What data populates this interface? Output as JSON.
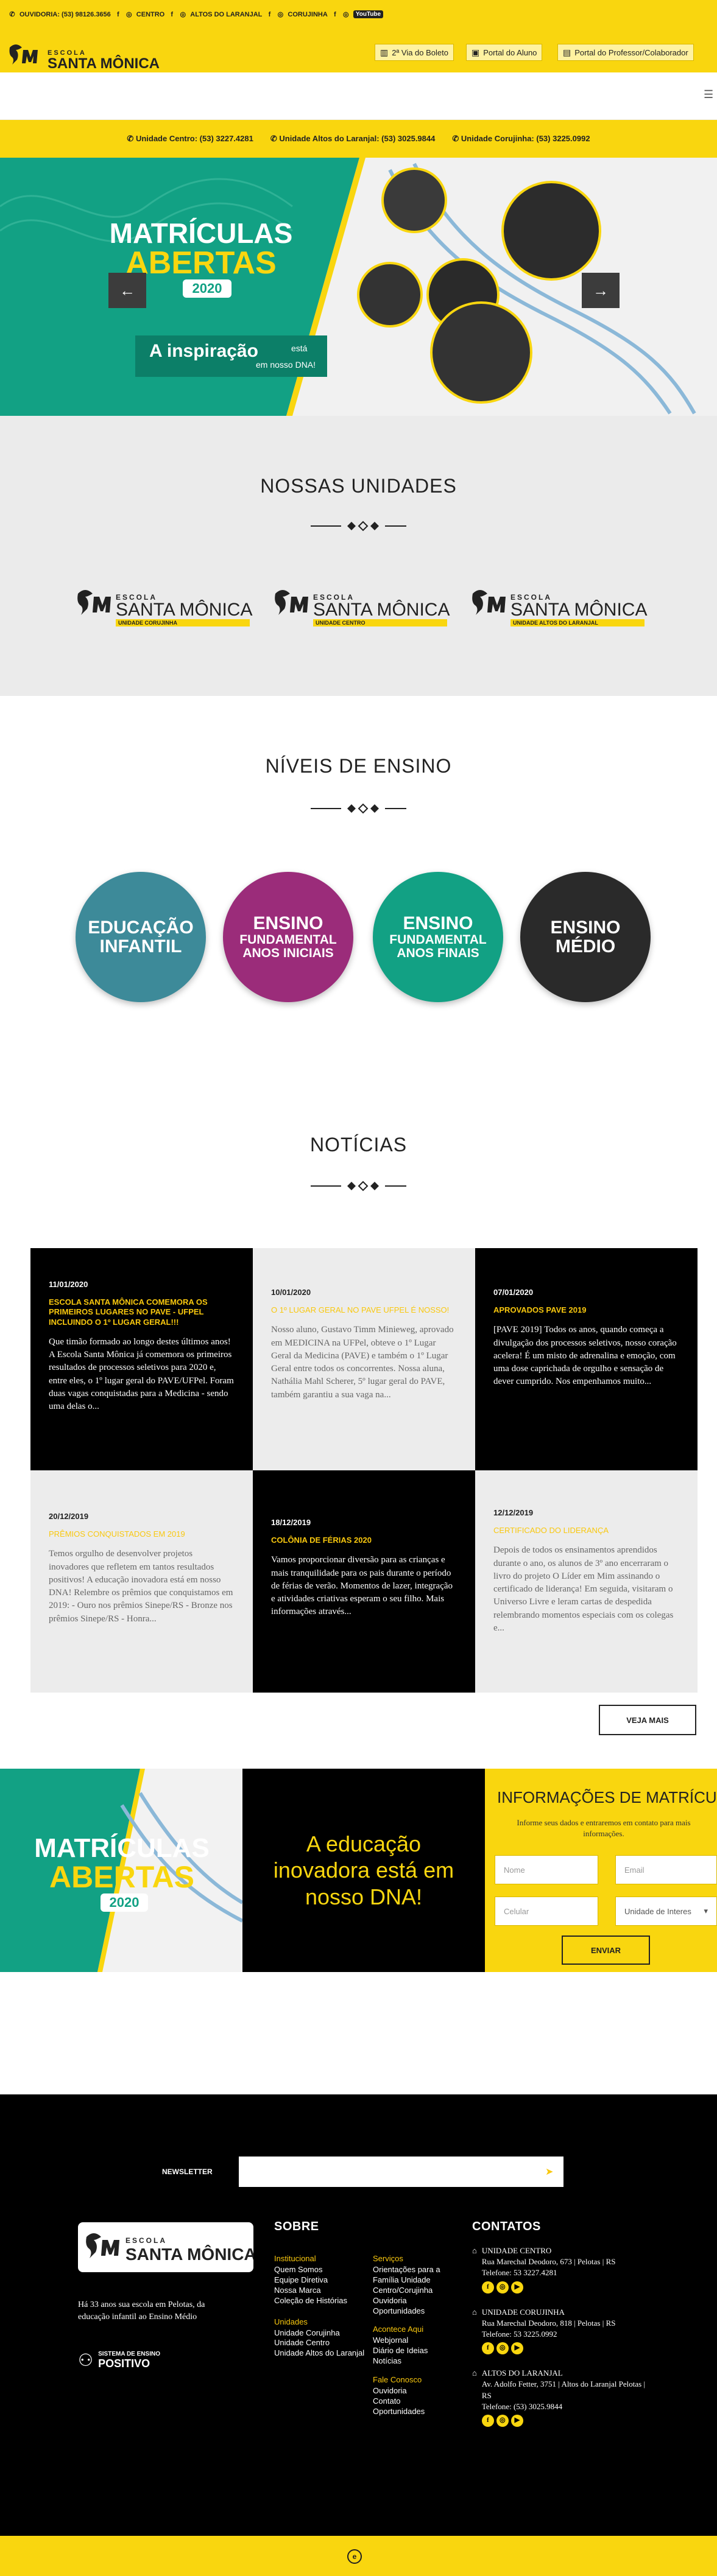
{
  "topbar": {
    "ouvidoria": "OUVIDORIA: (53) 98126.3656",
    "centro": "CENTRO",
    "altos": "ALTOS DO LARANJAL",
    "corujinha": "CORUJINHA",
    "youtube": "YouTube"
  },
  "header": {
    "logo_school": "ESCOLA",
    "logo_name": "SANTA MÔNICA",
    "portals": [
      "2ª Via do Boleto",
      "Portal do Aluno",
      "Portal do Professor/Colaborador"
    ]
  },
  "phones": [
    "Unidade Centro: (53) 3227.4281",
    "Unidade Altos do Laranjal: (53) 3025.9844",
    "Unidade Corujinha: (53) 3225.0992"
  ],
  "hero": {
    "line1": "MATRÍCULAS",
    "line2": "ABERTAS",
    "year": "2020",
    "tagline_bold": "A inspiração",
    "tagline_small1": "está",
    "tagline_small2": "em nosso DNA!",
    "prev": "←",
    "next": "→"
  },
  "units": {
    "title": "NOSSAS UNIDADES",
    "items": [
      {
        "school": "ESCOLA",
        "name": "SANTA MÔNICA",
        "sub": "UNIDADE CORUJINHA"
      },
      {
        "school": "ESCOLA",
        "name": "SANTA MÔNICA",
        "sub": "UNIDADE CENTRO"
      },
      {
        "school": "ESCOLA",
        "name": "SANTA MÔNICA",
        "sub": "UNIDADE ALTOS DO LARANJAL"
      }
    ]
  },
  "levels": {
    "title": "NÍVEIS DE ENSINO",
    "items": [
      {
        "l1": "EDUCAÇÃO",
        "l2": "INFANTIL",
        "l3": "",
        "color": "#3d8a99"
      },
      {
        "l1": "ENSINO",
        "l2": "FUNDAMENTAL",
        "l3": "ANOS INICIAIS",
        "color": "#9b2c7a"
      },
      {
        "l1": "ENSINO",
        "l2": "FUNDAMENTAL",
        "l3": "ANOS FINAIS",
        "color": "#12a184"
      },
      {
        "l1": "ENSINO",
        "l2": "MÉDIO",
        "l3": "",
        "color": "#2a2a2a"
      }
    ]
  },
  "news": {
    "title": "NOTÍCIAS",
    "more": "VEJA MAIS",
    "items": [
      {
        "date": "11/01/2020",
        "title": "ESCOLA SANTA MÔNICA COMEMORA OS PRIMEIROS LUGARES NO PAVE - UFPEL INCLUINDO O 1º LUGAR GERAL!!!",
        "excerpt": "Que timão formado ao longo destes últimos anos! A Escola Santa Mônica já comemora os primeiros resultados de processos seletivos para 2020 e, entre eles, o 1º lugar geral do PAVE/UFPel. Foram duas vagas conquistadas para a Medicina - sendo uma delas o..."
      },
      {
        "date": "10/01/2020",
        "title": "O 1º LUGAR GERAL NO PAVE UFPEL É NOSSO!",
        "excerpt": "Nosso aluno, Gustavo Timm Minieweg, aprovado em MEDICINA na UFPel, obteve o 1º Lugar Geral da Medicina (PAVE) e também o 1º Lugar Geral entre todos os concorrentes. Nossa aluna, Nathália Mahl Scherer, 5º lugar geral do PAVE, também garantiu a sua vaga na..."
      },
      {
        "date": "07/01/2020",
        "title": "APROVADOS PAVE 2019",
        "excerpt": "[PAVE 2019] Todos os anos, quando começa a divulgação dos processos seletivos, nosso coração acelera! É um misto de adrenalina e emoção, com uma dose caprichada de orgulho e sensação de dever cumprido. Nos empenhamos muito..."
      },
      {
        "date": "20/12/2019",
        "title": "PRÊMIOS CONQUISTADOS EM 2019",
        "excerpt": "Temos orgulho de desenvolver projetos inovadores que refletem em tantos resultados positivos! A educação inovadora está em nosso DNA! Relembre os prêmios que conquistamos em 2019: - Ouro nos prêmios Sinepe/RS - Bronze nos prêmios Sinepe/RS - Honra..."
      },
      {
        "date": "18/12/2019",
        "title": "COLÔNIA DE FÉRIAS 2020",
        "excerpt": "Vamos proporcionar diversão para as crianças e mais tranquilidade para os pais durante o período de férias de verão. Momentos de lazer, integração e atividades criativas esperam o seu filho. Mais informações através..."
      },
      {
        "date": "12/12/2019",
        "title": "CERTIFICADO DO LIDERANÇA",
        "excerpt": "Depois de todos os ensinamentos aprendidos durante o ano, os alunos de 3º ano encerraram o livro do projeto O Líder em Mim assinando o certificado de liderança! Em seguida, visitaram o Universo Livre e leram cartas de despedida relembrando momentos especiais com os colegas e..."
      }
    ]
  },
  "banner": {
    "l1": "MATRÍCULAS",
    "l2": "ABERTAS",
    "year": "2020",
    "mid": "A educação inovadora está em nosso DNA!"
  },
  "form": {
    "title": "INFORMAÇÕES DE MATRÍCULA",
    "subtitle": "Informe seus dados e entraremos em contato para mais informações.",
    "name": "Nome",
    "email": "Email",
    "phone": "Celular",
    "unit": "Unidade de Interes",
    "submit": "ENVIAR"
  },
  "footer": {
    "newsletter": "NEWSLETTER",
    "about": "Há 33 anos sua escola em Pelotas, da educação infantil ao Ensino Médio",
    "positivo1": "SISTEMA DE ENSINO",
    "positivo2": "POSITIVO",
    "sobre": "SOBRE",
    "col1": [
      {
        "cat": "Institucional",
        "links": [
          "Quem Somos",
          "Equipe Diretiva",
          "Nossa Marca",
          "Coleção de Histórias"
        ]
      },
      {
        "cat": "Unidades",
        "links": [
          "Unidade Corujinha",
          "Unidade Centro",
          "Unidade Altos do Laranjal"
        ]
      }
    ],
    "col2": [
      {
        "cat": "Serviços",
        "links": [
          "Orientações para a Família Unidade Centro/Corujinha",
          "Ouvidoria",
          "Oportunidades"
        ]
      },
      {
        "cat": "Acontece Aqui",
        "links": [
          "Webjornal",
          "Diário de Ideias",
          "Notícias"
        ]
      },
      {
        "cat": "Fale Conosco",
        "links": [
          "Ouvidoria",
          "Contato",
          "Oportunidades"
        ]
      }
    ],
    "contatos": "CONTATOS",
    "units": [
      {
        "name": "UNIDADE CENTRO",
        "addr": "Rua Marechal Deodoro, 673 | Pelotas | RS",
        "tel": "Telefone: 53 3227.4281"
      },
      {
        "name": "UNIDADE CORUJINHA",
        "addr": "Rua Marechal Deodoro, 818 | Pelotas | RS",
        "tel": "Telefone: 53 3225.0992"
      },
      {
        "name": "ALTOS DO LARANJAL",
        "addr": "Av. Adolfo Fetter, 3751 | Altos do Laranjal Pelotas | RS",
        "tel": "Telefone: (53) 3025.9844"
      }
    ]
  },
  "colors": {
    "brand_yellow": "#f9d60f",
    "teal": "#12a184",
    "dark": "#000000"
  }
}
